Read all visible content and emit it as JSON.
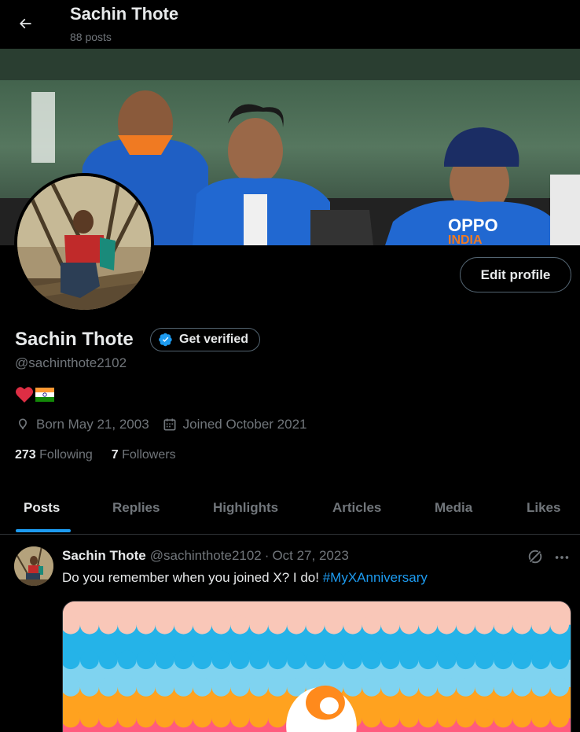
{
  "header": {
    "title": "Sachin Thote",
    "subtitle": "88 posts"
  },
  "profile": {
    "name": "Sachin Thote",
    "get_verified_label": "Get verified",
    "handle": "@sachinthote2102",
    "edit_profile_label": "Edit profile",
    "bio_icons": [
      "heart-icon",
      "india-flag-icon"
    ],
    "born": "Born May 21, 2003",
    "joined": "Joined October 2021",
    "following_count": "273",
    "following_label": "Following",
    "followers_count": "7",
    "followers_label": "Followers"
  },
  "tabs": [
    {
      "label": "Posts",
      "active": true
    },
    {
      "label": "Replies",
      "active": false
    },
    {
      "label": "Highlights",
      "active": false
    },
    {
      "label": "Articles",
      "active": false
    },
    {
      "label": "Media",
      "active": false
    },
    {
      "label": "Likes",
      "active": false
    }
  ],
  "post": {
    "author_name": "Sachin Thote",
    "author_handle": "@sachinthote2102",
    "separator": "·",
    "date": "Oct 27, 2023",
    "text": "Do you remember when you joined X? I do!",
    "hashtag": "#MyXAnniversary"
  },
  "colors": {
    "background": "#000000",
    "text_primary": "#e7e9ea",
    "text_secondary": "#71767b",
    "accent": "#1d9bf0",
    "border": "#536471"
  }
}
